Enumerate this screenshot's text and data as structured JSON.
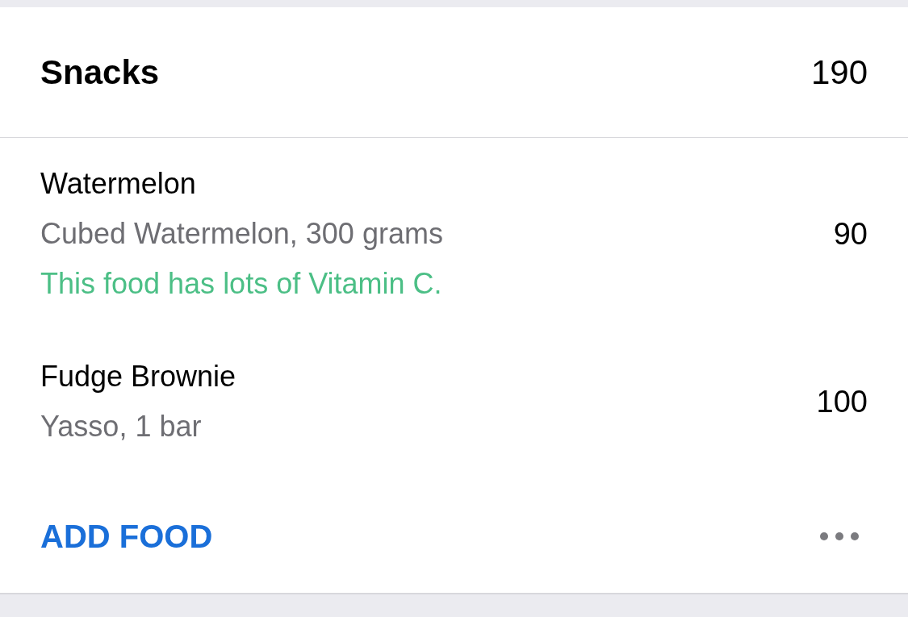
{
  "meal": {
    "title": "Snacks",
    "calories": "190"
  },
  "foods": [
    {
      "name": "Watermelon",
      "detail": "Cubed Watermelon, 300 grams",
      "note": "This food has lots of Vitamin C.",
      "calories": "90"
    },
    {
      "name": "Fudge Brownie",
      "detail": "Yasso, 1 bar",
      "calories": "100"
    }
  ],
  "footer": {
    "add_label": "ADD FOOD"
  }
}
